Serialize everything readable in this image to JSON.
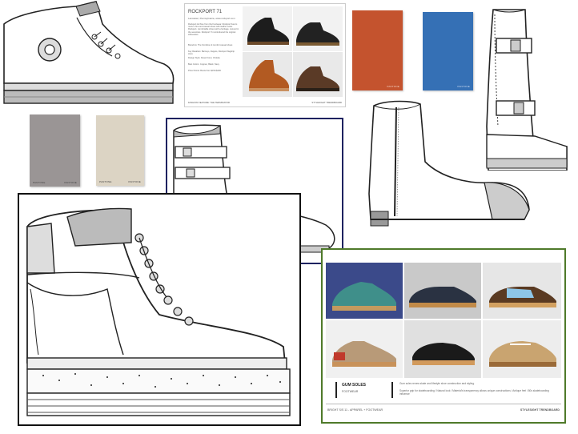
{
  "colors": {
    "orange": "#C4532E",
    "blue": "#3570B5",
    "gray": "#9A9595",
    "beige": "#DCD4C4",
    "navy_frame": "#1E2260",
    "green_frame": "#4F7A2A",
    "black_frame": "#111111"
  },
  "rockport_board": {
    "title": "ROCKPORT 71",
    "subtitle": "Lancaster, Pennsylvania, www.rockport.com",
    "desc": "Rockport Archive from the Footwear. Rockport has its roots in fine and casual shoes with leather soles. Rockport, comfortable shoes with a heritage, revived in the seventies. Rockport 71 reintroduced the original silhouettes.",
    "brand_line": "Brand As: The Frontline of comfort casual shoes",
    "key_retailers": "Key Retailers: Barneys, Zappos, Rockport flagship store",
    "design_style": "Design Style: Desert boot, Chukka",
    "best_colors": "Best Colors: Cognac, Black, Navy",
    "price_points": "Price Points: Boots from $150-$200",
    "footer_left": "FASHION FEATURE: THE TERMINATOR",
    "footer_right": "STYLESIGHT TRENDBOARD"
  },
  "swatches": {
    "orange_label": "PANTONE",
    "blue_label": "PANTONE",
    "gray_label_left": "PANTONE",
    "gray_label_right": "PANTONE",
    "beige_label_left": "PANTONE",
    "beige_label_right": "PANTONE"
  },
  "gum_board": {
    "title": "GUM SOLES",
    "subtitle": "FOOTWEAR",
    "desc1": "Gum soles renew skate and lifestyle shoe construction and styling.",
    "desc2": "Superior grip for skateboarding / Natural look / Material's transparency allows unique constructions / Antique feel / 80s skateboarding influence",
    "footer_left": "BRIGHT S/S 11 - APPAREL + FOOTWEAR",
    "footer_right": "STYLESIGHT TRENDBOARD"
  }
}
